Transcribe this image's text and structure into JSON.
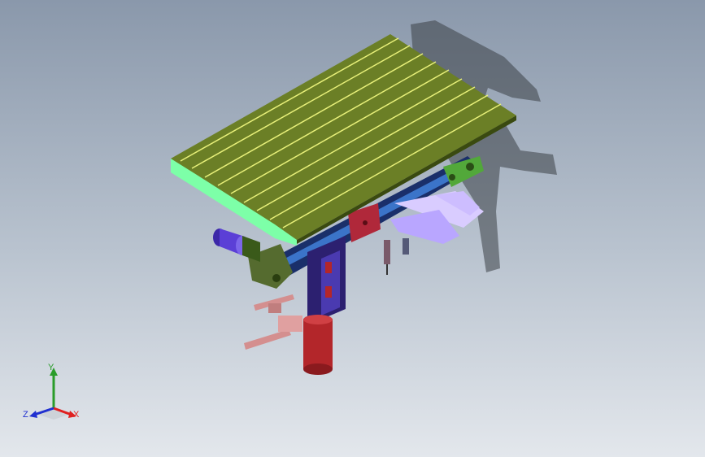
{
  "viewport": {
    "colors": {
      "tabletop": "#6b7f26",
      "tabletop_dark": "#4d5e16",
      "tabletop_edge": "#7dffa8",
      "groove": "#e8f07a",
      "belt_frame": "#556b2f",
      "drive_motor": "#5b3fd6",
      "post": "#b3262a",
      "bracket": "#3a2a8c",
      "plate": "#b0283a",
      "gripper": "#b9a6ff",
      "pins": "#d48f8f",
      "shadow": "#3a3f46"
    }
  },
  "triad": {
    "x_label": "X",
    "y_label": "Y",
    "z_label": "Z",
    "x_color": "#e02020",
    "y_color": "#2a9c2a",
    "z_color": "#2030d0"
  }
}
